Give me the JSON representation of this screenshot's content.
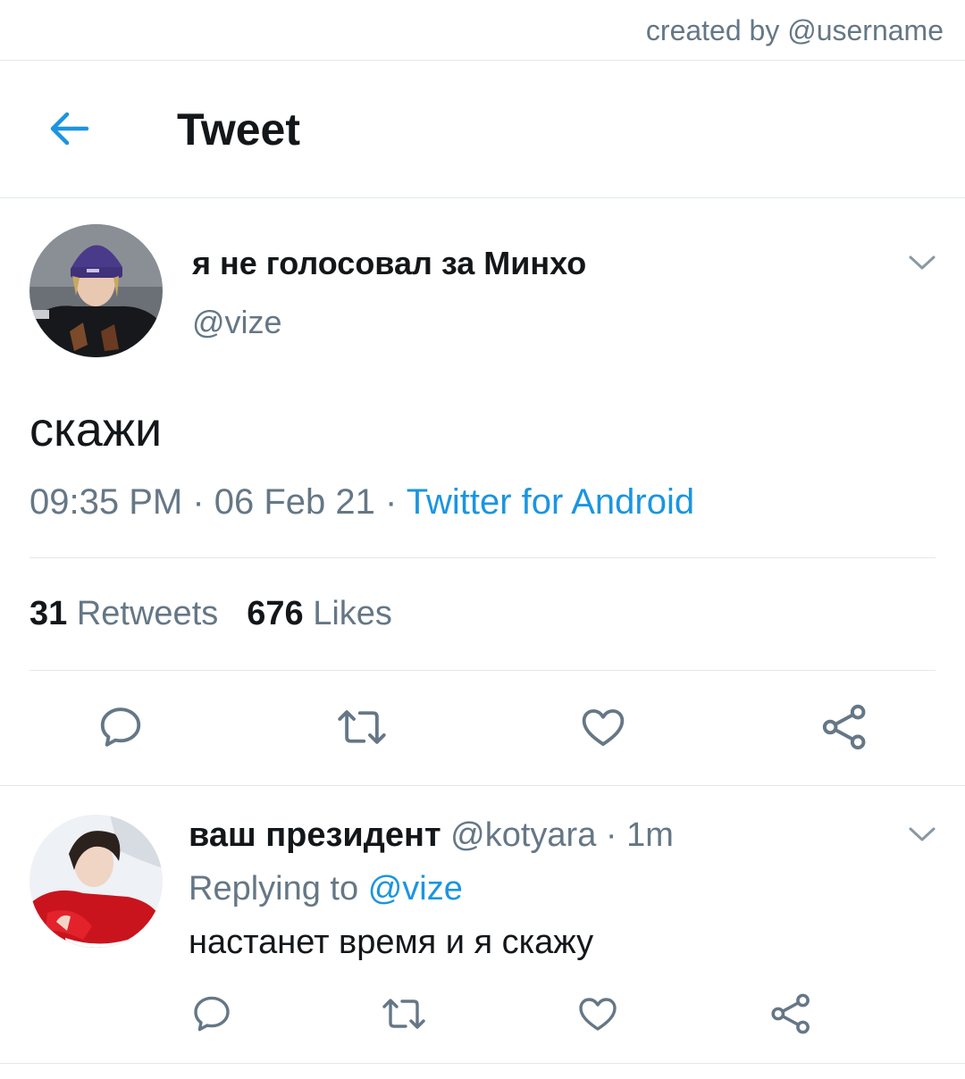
{
  "credit": "created by @username",
  "header": {
    "title": "Tweet"
  },
  "tweet": {
    "display_name": "я не голосовал за Минхо",
    "handle": "@vize",
    "text": "скажи",
    "time": "09:35 PM",
    "date": "06 Feb 21",
    "source": "Twitter for Android",
    "retweets_count": "31",
    "retweets_label": "Retweets",
    "likes_count": "676",
    "likes_label": "Likes"
  },
  "reply": {
    "display_name": "ваш президент",
    "handle": "@kotyara",
    "time": "1m",
    "replying_label": "Replying to",
    "replying_to": "@vize",
    "text": "настанет время и я скажу"
  },
  "icons": [
    "back-arrow-icon",
    "chevron-down-icon",
    "reply-icon",
    "retweet-icon",
    "like-icon",
    "share-icon"
  ],
  "colors": {
    "accent": "#1b95e0",
    "secondary_text": "#657786",
    "icon": "#657786",
    "divider": "#e1e8ed"
  }
}
